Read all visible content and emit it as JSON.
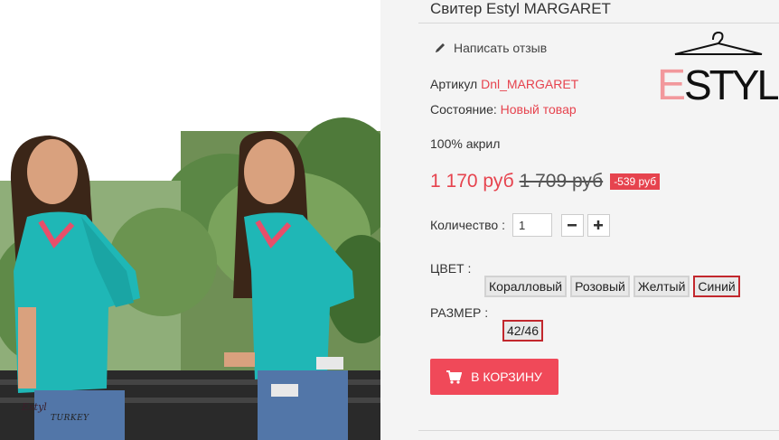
{
  "product": {
    "title": "Свитер Estyl MARGARET",
    "review_label": "Написать отзыв",
    "reference_label": "Артикул",
    "reference_value": "Dnl_MARGARET",
    "condition_label": "Состояние:",
    "condition_value": "Новый товар",
    "composition": "100% акрил"
  },
  "pricing": {
    "price": "1 170 руб",
    "old_price": "1 709 руб",
    "discount": "-539 руб"
  },
  "quantity": {
    "label": "Количество :",
    "value": "1",
    "minus_icon": "minus-icon",
    "plus_icon": "plus-icon"
  },
  "attributes": {
    "color_label": "ЦВЕТ :",
    "colors": [
      "Коралловый",
      "Розовый",
      "Желтый",
      "Синий"
    ],
    "selected_color": "Синий",
    "size_label": "РАЗМЕР :",
    "sizes": [
      "42/46"
    ],
    "selected_size": "42/46"
  },
  "cart": {
    "label": "В КОРЗИНУ",
    "icon": "cart-icon",
    "color": "#f04959"
  },
  "brand": {
    "logo_letter": "E",
    "logo_text": "STYL",
    "accent": "#e6434e"
  },
  "watermark": {
    "line1": "Estyl",
    "line2": "TURKEY"
  }
}
